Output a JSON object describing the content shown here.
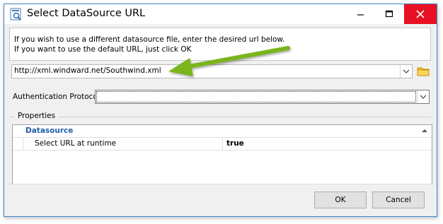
{
  "window": {
    "title": "Select DataSource URL"
  },
  "message": {
    "line1": "If you wish to use a different datasource file, enter the desired url below.",
    "line2": "If you want to use the default URL, just click OK"
  },
  "url_combo": {
    "value": "http://xml.windward.net/Southwind.xml"
  },
  "auth": {
    "label": "Authentication Protocol",
    "value": ""
  },
  "properties": {
    "legend": "Properties",
    "category": "Datasource",
    "rows": [
      {
        "name": "Select URL at runtime",
        "value": "true"
      }
    ]
  },
  "buttons": {
    "ok": "OK",
    "cancel": "Cancel"
  },
  "colors": {
    "arrow": "#7ab51d",
    "close_bg": "#e81123",
    "category_text": "#1e5ea8",
    "window_border": "#3f84c6"
  },
  "icons": [
    "app-icon",
    "minimize-icon",
    "maximize-icon",
    "close-icon",
    "chevron-down-icon",
    "folder-icon",
    "collapse-icon",
    "annotation-arrow"
  ]
}
